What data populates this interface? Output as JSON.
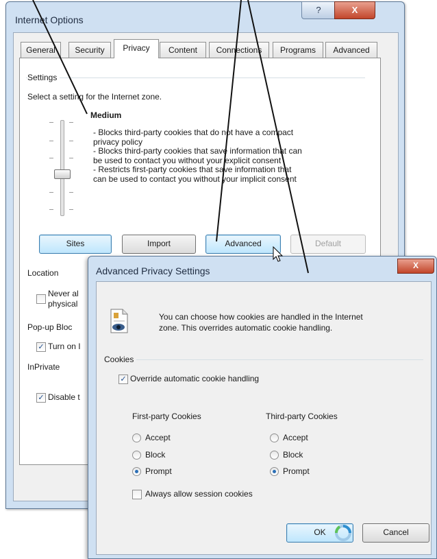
{
  "internet_options": {
    "title": "Internet Options",
    "help_glyph": "?",
    "close_glyph": "X",
    "tabs": [
      "General",
      "Security",
      "Privacy",
      "Content",
      "Connections",
      "Programs",
      "Advanced"
    ],
    "active_tab": "Privacy",
    "settings_label": "Settings",
    "zone_prompt": "Select a setting for the Internet zone.",
    "level": "Medium",
    "description_lines": [
      "- Blocks third-party cookies that do not have a compact",
      "privacy policy",
      "- Blocks third-party cookies that save information that can",
      "be used to contact you without your explicit consent",
      "- Restricts first-party cookies that save information that",
      "can be used to contact you without your implicit consent"
    ],
    "buttons": {
      "sites": "Sites",
      "import": "Import",
      "advanced": "Advanced",
      "default": "Default"
    },
    "location_label": "Location",
    "location_check_line1": "Never al",
    "location_check_line2": "physical",
    "popup_label": "Pop-up Bloc",
    "popup_check": "Turn on I",
    "inprivate_label": "InPrivate",
    "inprivate_check": "Disable t"
  },
  "advanced_privacy": {
    "title": "Advanced Privacy Settings",
    "close_glyph": "X",
    "info_line1": "You can choose how cookies are handled in the Internet",
    "info_line2": "zone.  This overrides automatic cookie handling.",
    "cookies_label": "Cookies",
    "override_label": "Override automatic cookie handling",
    "first_party_header": "First-party Cookies",
    "third_party_header": "Third-party Cookies",
    "options": [
      "Accept",
      "Block",
      "Prompt"
    ],
    "first_party_selected": "Prompt",
    "third_party_selected": "Prompt",
    "session_label": "Always allow session cookies",
    "ok": "OK",
    "cancel": "Cancel"
  },
  "colors": {
    "title_bar": "#cfe0f2",
    "close_red": "#c2462b",
    "dialog_face": "#f0f0f0"
  }
}
